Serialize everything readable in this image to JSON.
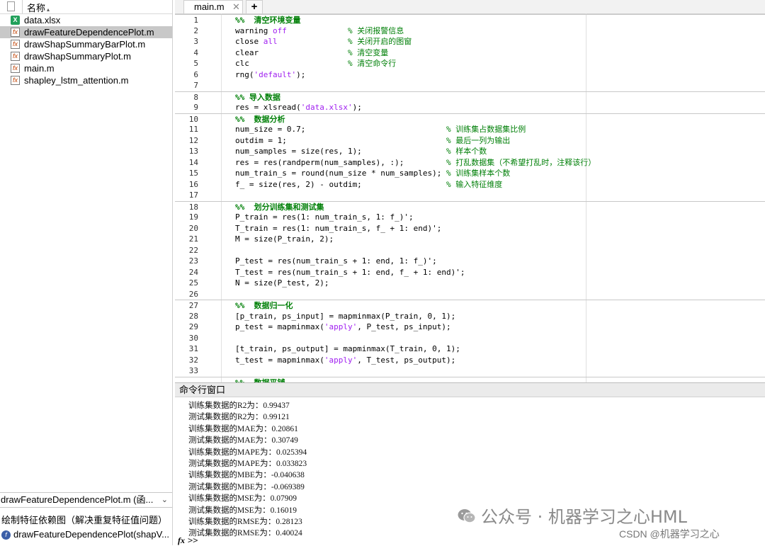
{
  "file_browser": {
    "header": {
      "name_col": "名称",
      "sort_indicator": "▴"
    },
    "files": [
      {
        "name": "data.xlsx",
        "icon": "xlsx-file-icon",
        "selected": false
      },
      {
        "name": "drawFeatureDependencePlot.m",
        "icon": "m-file-icon",
        "selected": true
      },
      {
        "name": "drawShapSummaryBarPlot.m",
        "icon": "m-file-icon",
        "selected": false
      },
      {
        "name": "drawShapSummaryPlot.m",
        "icon": "m-file-icon",
        "selected": false
      },
      {
        "name": "main.m",
        "icon": "m-file-icon",
        "selected": false
      },
      {
        "name": "shapley_lstm_attention.m",
        "icon": "m-file-icon",
        "selected": false
      }
    ],
    "details": {
      "selected_label": "drawFeatureDependencePlot.m (函...",
      "description": "绘制特征依赖图（解决重复特征值问题）",
      "function_sig": "drawFeatureDependencePlot(shapV..."
    }
  },
  "editor": {
    "tabs": [
      {
        "label": "main.m",
        "close": "✕"
      }
    ],
    "add_tab": "+",
    "lines": [
      {
        "n": "1",
        "section": true,
        "head": true,
        "html": "%%  清空环境变量"
      },
      {
        "n": "2",
        "html": "warning <span class='kw'>off</span>             <span class='cmt'>% 关闭报警信息</span>"
      },
      {
        "n": "3",
        "html": "close <span class='kw'>all</span>               <span class='cmt'>% 关闭开启的图窗</span>"
      },
      {
        "n": "4",
        "html": "clear                   <span class='cmt'>% 清空变量</span>"
      },
      {
        "n": "5",
        "html": "clc                     <span class='cmt'>% 清空命令行</span>"
      },
      {
        "n": "6",
        "html": "rng(<span class='str'>'default'</span>);"
      },
      {
        "n": "7",
        "html": ""
      },
      {
        "n": "8",
        "section": true,
        "head": true,
        "html": "%% 导入数据"
      },
      {
        "n": "9",
        "html": "res = xlsread(<span class='str'>'data.xlsx'</span>);"
      },
      {
        "n": "10",
        "section": true,
        "head": true,
        "html": "%%  数据分析"
      },
      {
        "n": "11",
        "html": "num_size = 0.7;                              <span class='cmt'>% 训练集占数据集比例</span>"
      },
      {
        "n": "12",
        "html": "outdim = 1;                                  <span class='cmt'>% 最后一列为输出</span>"
      },
      {
        "n": "13",
        "html": "num_samples = size(res, 1);                  <span class='cmt'>% 样本个数</span>"
      },
      {
        "n": "14",
        "html": "res = res(randperm(num_samples), :);         <span class='cmt'>% 打乱数据集（不希望打乱时，注释该行）</span>"
      },
      {
        "n": "15",
        "html": "num_train_s = round(num_size * num_samples); <span class='cmt'>% 训练集样本个数</span>"
      },
      {
        "n": "16",
        "html": "f_ = size(res, 2) - outdim;                  <span class='cmt'>% 输入特征维度</span>"
      },
      {
        "n": "17",
        "html": ""
      },
      {
        "n": "18",
        "section": true,
        "head": true,
        "html": "%%  划分训练集和测试集"
      },
      {
        "n": "19",
        "html": "P_train = res(1: num_train_s, 1: f_)';"
      },
      {
        "n": "20",
        "html": "T_train = res(1: num_train_s, f_ + 1: end)';"
      },
      {
        "n": "21",
        "html": "M = size(P_train, 2);"
      },
      {
        "n": "22",
        "html": ""
      },
      {
        "n": "23",
        "html": "P_test = res(num_train_s + 1: end, 1: f_)';"
      },
      {
        "n": "24",
        "html": "T_test = res(num_train_s + 1: end, f_ + 1: end)';"
      },
      {
        "n": "25",
        "html": "N = size(P_test, 2);"
      },
      {
        "n": "26",
        "html": ""
      },
      {
        "n": "27",
        "section": true,
        "head": true,
        "html": "%%  数据归一化"
      },
      {
        "n": "28",
        "html": "[p_train, ps_input] = mapminmax(P_train, 0, 1);"
      },
      {
        "n": "29",
        "html": "p_test = mapminmax(<span class='str'>'apply'</span>, P_test, ps_input);"
      },
      {
        "n": "30",
        "html": ""
      },
      {
        "n": "31",
        "html": "[t_train, ps_output] = mapminmax(T_train, 0, 1);"
      },
      {
        "n": "32",
        "html": "t_test = mapminmax(<span class='str'>'apply'</span>, T_test, ps_output);"
      },
      {
        "n": "33",
        "html": ""
      },
      {
        "n": "",
        "section": true,
        "head": true,
        "html": "%%  数据平铺"
      }
    ]
  },
  "command_window": {
    "title": "命令行窗口",
    "output": [
      "训练集数据的R2为：0.99437",
      "测试集数据的R2为：0.99121",
      "训练集数据的MAE为：0.20861",
      "测试集数据的MAE为：0.30749",
      "训练集数据的MAPE为：0.025394",
      "测试集数据的MAPE为：0.033823",
      "训练集数据的MBE为：-0.040638",
      "测试集数据的MBE为：-0.069389",
      "训练集数据的MSE为：0.07909",
      "测试集数据的MSE为：0.16019",
      "训练集数据的RMSE为：0.28123",
      "测试集数据的RMSE为：0.40024"
    ],
    "prompt_fx": "fx",
    "prompt": ">>"
  },
  "watermark": {
    "text": "公众号 · 机器学习之心HML",
    "icon": "wechat-icon"
  },
  "csdn_credit": "CSDN @机器学习之心"
}
